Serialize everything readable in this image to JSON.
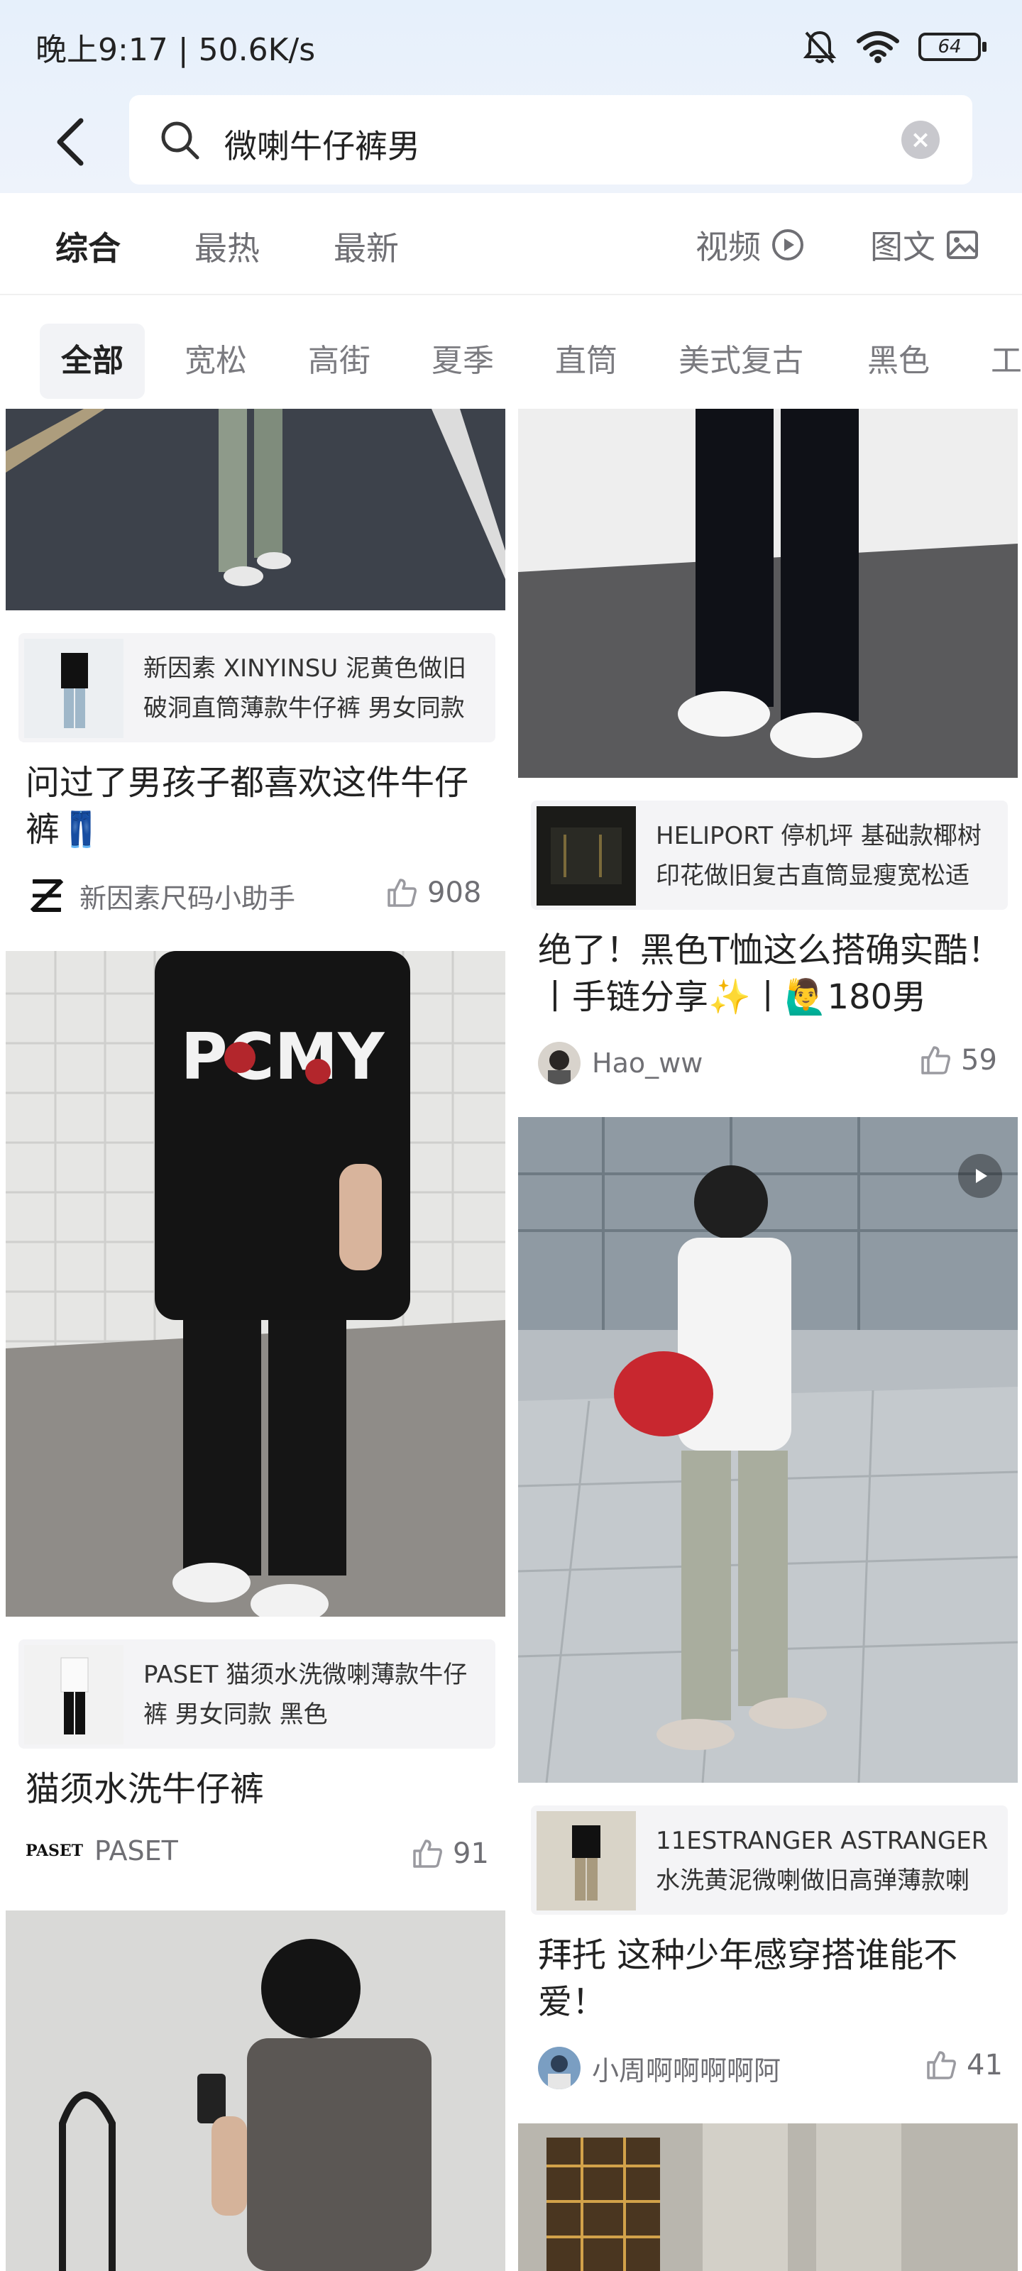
{
  "status_bar": {
    "time": "晚上9:17 | 50.6K/s",
    "battery": "64"
  },
  "search": {
    "query": "微喇牛仔裤男"
  },
  "tabs": [
    {
      "label": "综合",
      "active": true
    },
    {
      "label": "最热"
    },
    {
      "label": "最新"
    }
  ],
  "tabs_right": [
    {
      "label": "视频",
      "icon": "play-circle-icon"
    },
    {
      "label": "图文",
      "icon": "image-icon"
    }
  ],
  "chips": [
    "全部",
    "宽松",
    "高街",
    "夏季",
    "直筒",
    "美式复古",
    "黑色",
    "工"
  ],
  "cards": {
    "left1": {
      "product": "新因素 XINYINSU 泥黄色做旧破洞直筒薄款牛仔裤 男女同款",
      "title": "问过了男孩子都喜欢这件牛仔裤👖",
      "author": "新因素尺码小助手",
      "likes": "908"
    },
    "left2": {
      "product": "PASET 猫须水洗微喇薄款牛仔裤  男女同款 黑色",
      "title": "猫须水洗牛仔裤",
      "author": "PASET",
      "author_logo": "PASET",
      "likes": "91"
    },
    "right1": {
      "product": "HELIPORT 停机坪 基础款椰树印花做旧复古直筒显瘦宽松适",
      "title": "绝了！黑色T恤这么搭确实酷！丨手链分享✨丨🙋‍♂️180男",
      "author": "Hao_ww",
      "likes": "59"
    },
    "right2": {
      "product": "11ESTRANGER ASTRANGER 水洗黄泥微喇做旧高弹薄款喇",
      "title": "拜托 这种少年感穿搭谁能不爱！",
      "author": "小周啊啊啊啊阿",
      "likes": "41"
    }
  },
  "colors": {
    "header_bg": "#e6f0fb",
    "accent_text": "#222222",
    "muted_text": "#6f6f74"
  }
}
